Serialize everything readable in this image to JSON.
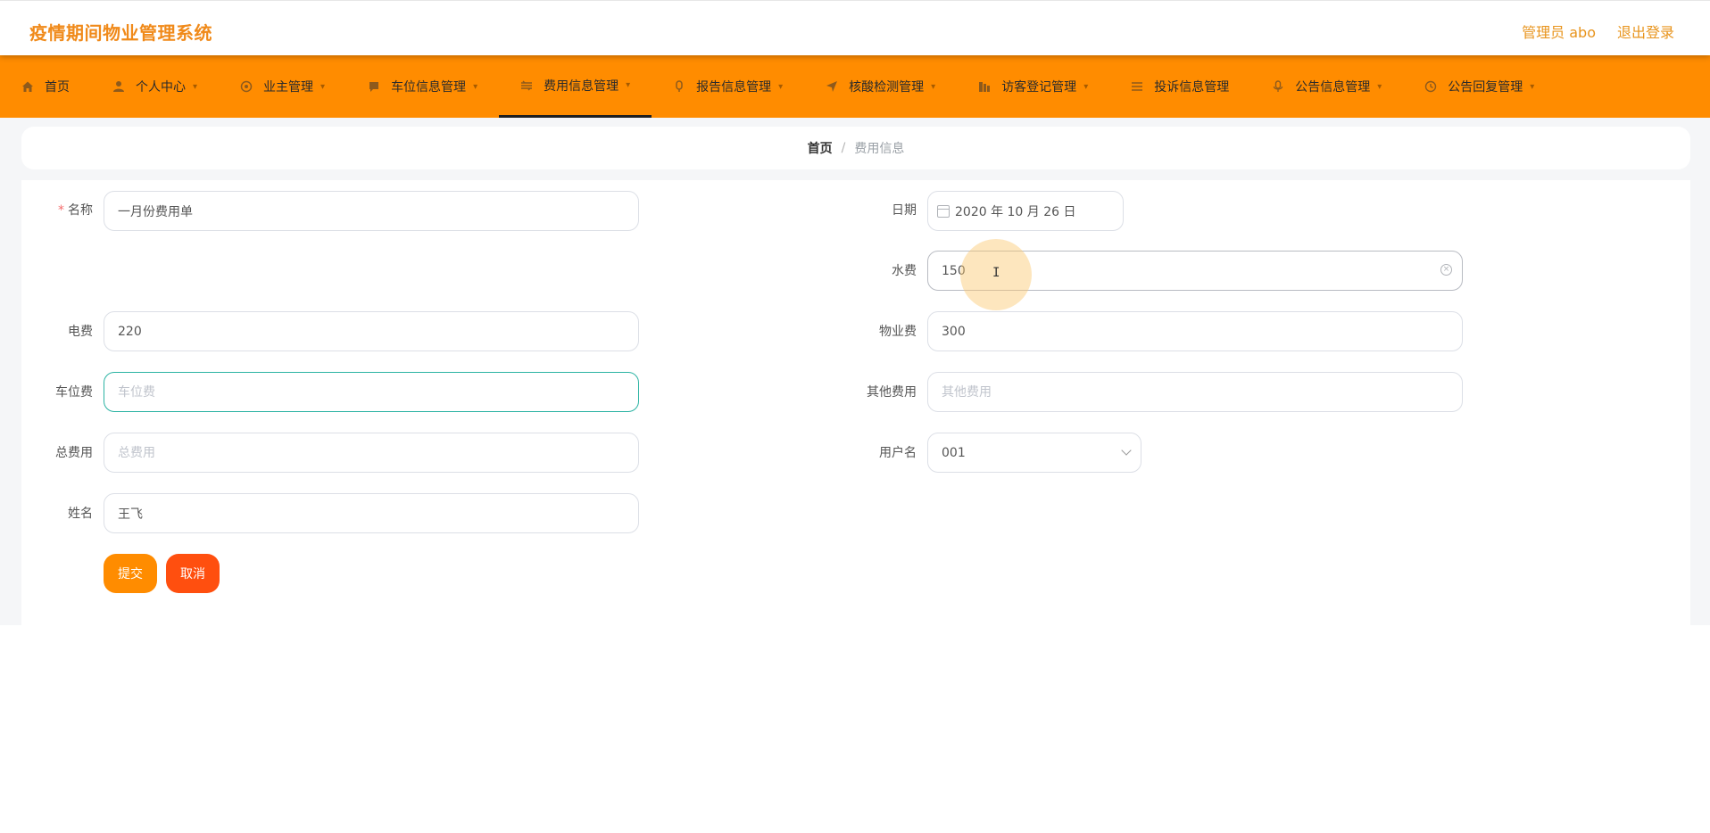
{
  "header": {
    "title": "疫情期间物业管理系统",
    "admin_label": "管理员 abo",
    "logout_label": "退出登录"
  },
  "nav": {
    "items": [
      {
        "label": "首页",
        "icon": "home-icon",
        "has_caret": false
      },
      {
        "label": "个人中心",
        "icon": "user-icon",
        "has_caret": true
      },
      {
        "label": "业主管理",
        "icon": "owner-icon",
        "has_caret": true
      },
      {
        "label": "车位信息管理",
        "icon": "parking-icon",
        "has_caret": true
      },
      {
        "label": "费用信息管理",
        "icon": "fee-icon",
        "has_caret": true,
        "active": true
      },
      {
        "label": "报告信息管理",
        "icon": "report-icon",
        "has_caret": true
      },
      {
        "label": "核酸检测管理",
        "icon": "test-icon",
        "has_caret": true
      },
      {
        "label": "访客登记管理",
        "icon": "visitor-icon",
        "has_caret": true
      },
      {
        "label": "投诉信息管理",
        "icon": "complaint-icon",
        "has_caret": true
      },
      {
        "label": "公告信息管理",
        "icon": "notice-icon",
        "has_caret": true
      },
      {
        "label": "公告回复管理",
        "icon": "reply-icon",
        "has_caret": true
      }
    ]
  },
  "breadcrumb": {
    "home": "首页",
    "separator": "/",
    "current": "费用信息"
  },
  "form": {
    "name": {
      "label": "名称",
      "value": "一月份费用单",
      "required": true
    },
    "date": {
      "label": "日期",
      "value": "2020 年 10 月 26 日"
    },
    "water": {
      "label": "水费",
      "value": "150"
    },
    "electric": {
      "label": "电费",
      "value": "220"
    },
    "property": {
      "label": "物业费",
      "value": "300"
    },
    "parking": {
      "label": "车位费",
      "value": "",
      "placeholder": "车位费"
    },
    "other": {
      "label": "其他费用",
      "value": "",
      "placeholder": "其他费用"
    },
    "total": {
      "label": "总费用",
      "value": "",
      "placeholder": "总费用"
    },
    "username": {
      "label": "用户名",
      "value": "001"
    },
    "realname": {
      "label": "姓名",
      "value": "王飞"
    },
    "submit_label": "提交",
    "cancel_label": "取消"
  },
  "colors": {
    "accent": "#ff8c00",
    "brand": "#f08a1a",
    "cancel": "#ff4f0f",
    "focus_border": "#2bb3a3"
  }
}
